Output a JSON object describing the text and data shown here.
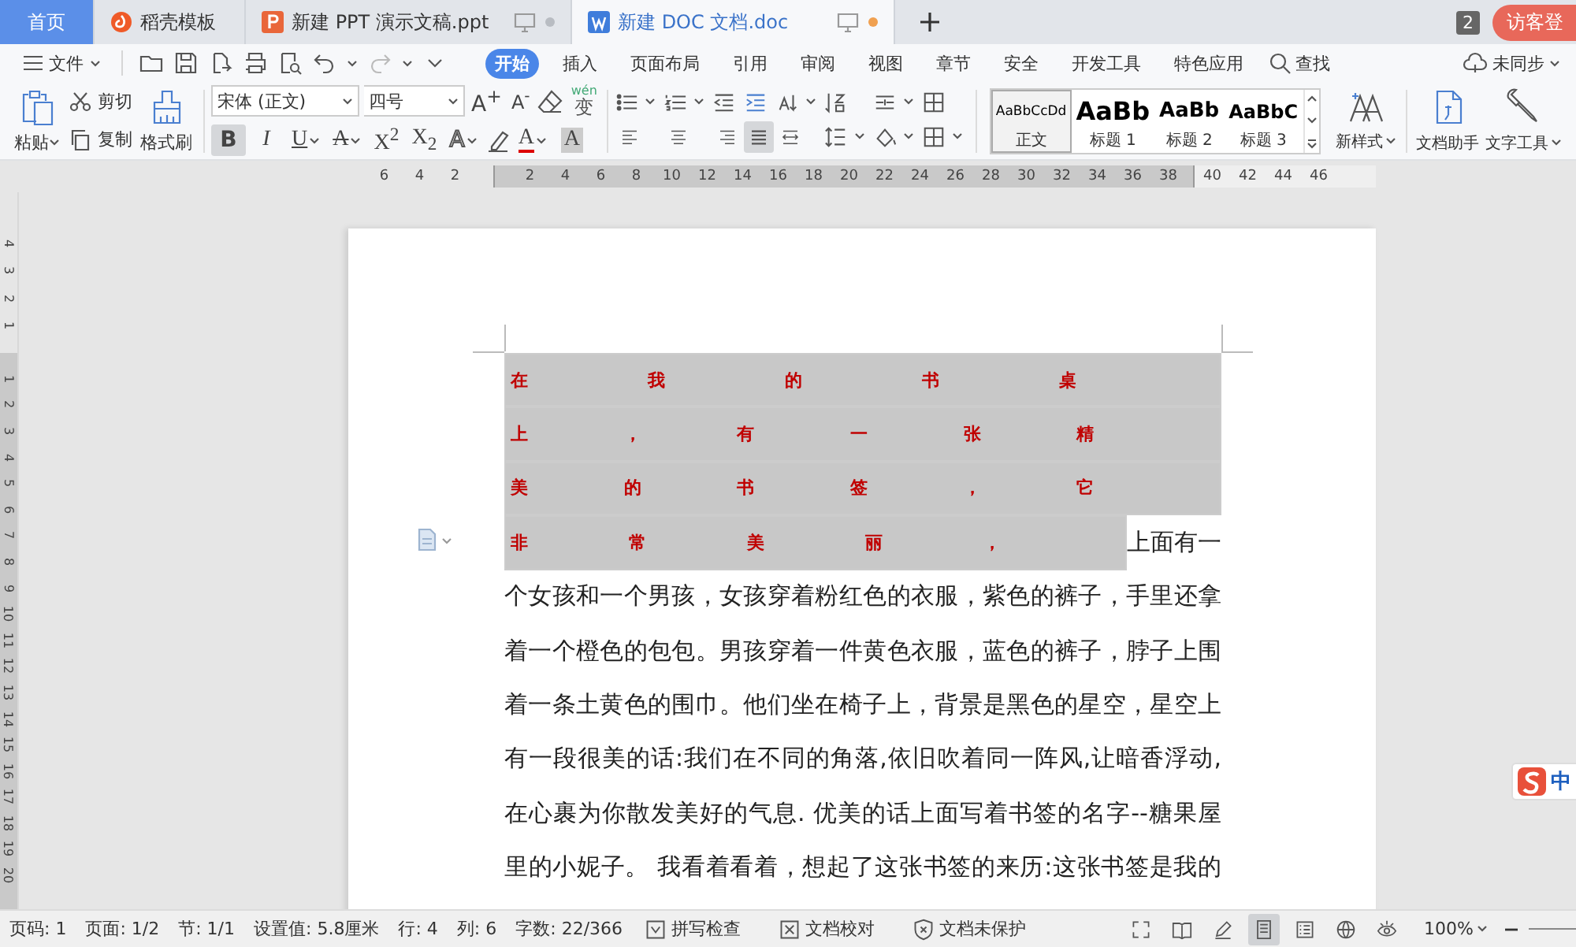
{
  "tab_bar": {
    "tabs": [
      {
        "label": "首页",
        "kind": "home",
        "selected": false
      },
      {
        "label": "稻壳模板",
        "kind": "template",
        "selected": false
      },
      {
        "label": "新建 PPT 演示文稿.ppt",
        "kind": "ppt",
        "selected": false,
        "unsaved": false
      },
      {
        "label": "新建 DOC 文档.doc",
        "kind": "doc",
        "selected": true,
        "unsaved": true
      }
    ],
    "window_count": "2",
    "login": "访客登"
  },
  "menu": {
    "file": "文件",
    "tabs": [
      {
        "label": "开始",
        "selected": true
      },
      {
        "label": "插入",
        "selected": false
      },
      {
        "label": "页面布局",
        "selected": false
      },
      {
        "label": "引用",
        "selected": false
      },
      {
        "label": "审阅",
        "selected": false
      },
      {
        "label": "视图",
        "selected": false
      },
      {
        "label": "章节",
        "selected": false
      },
      {
        "label": "安全",
        "selected": false
      },
      {
        "label": "开发工具",
        "selected": false
      },
      {
        "label": "特色应用",
        "selected": false
      }
    ],
    "search": "查找",
    "sync": "未同步"
  },
  "ribbon": {
    "clipboard": {
      "paste": "粘贴",
      "cut": "剪切",
      "copy": "复制",
      "format_painter": "格式刷"
    },
    "font": {
      "name": "宋体 (正文)",
      "size": "四号",
      "top_buttons": [
        {
          "label": "A$^{+}$",
          "kind": "grow",
          "selected": false
        },
        {
          "label": "A$^{-}$",
          "kind": "shrink",
          "selected": false
        }
      ],
      "phonetic": {
        "ruby": "wén",
        "label": "变"
      },
      "buttons": [
        {
          "label": "B",
          "kind": "bold",
          "selected": true
        },
        {
          "label": "I",
          "kind": "italic",
          "selected": false
        },
        {
          "label": "U",
          "kind": "underline",
          "selected": false
        },
        {
          "label": "A",
          "kind": "strike",
          "selected": false
        },
        {
          "label": "X$^{2}$",
          "kind": "sup",
          "selected": false
        },
        {
          "label": "X$_{2}$",
          "kind": "sub",
          "selected": false
        },
        {
          "label": "A",
          "kind": "effect",
          "selected": false
        },
        {
          "label": "A",
          "kind": "color",
          "selected": false
        },
        {
          "label": "A",
          "kind": "shade",
          "selected": false
        }
      ]
    },
    "alignment": [
      {
        "kind": "left",
        "selected": false
      },
      {
        "kind": "center",
        "selected": false
      },
      {
        "kind": "right",
        "selected": false
      },
      {
        "kind": "justify",
        "selected": true
      },
      {
        "kind": "distributed",
        "selected": false
      }
    ],
    "styles": [
      {
        "preview": "AaBbCcDd",
        "label": "正文",
        "kind": "body",
        "selected": true
      },
      {
        "preview": "AaBb",
        "label": "标题 1",
        "kind": "heading1",
        "selected": false
      },
      {
        "preview": "AaBb",
        "label": "标题 2",
        "kind": "heading2",
        "selected": false
      },
      {
        "preview": "AaBbC",
        "label": "标题 3",
        "kind": "heading3",
        "selected": false
      }
    ],
    "new_style": "新样式",
    "tools": [
      {
        "label": "文档助手",
        "kind": "assistant"
      },
      {
        "label": "文字工具",
        "kind": "text-tools"
      }
    ]
  },
  "ruler": {
    "left_marks": [
      "6",
      "4",
      "2"
    ],
    "marks": [
      "2",
      "4",
      "6",
      "8",
      "10",
      "12",
      "14",
      "16",
      "18",
      "20",
      "22",
      "24",
      "26",
      "28",
      "30",
      "32",
      "34",
      "36",
      "38"
    ],
    "right_marks": [
      "40",
      "42",
      "44",
      "46"
    ]
  },
  "vertical_ruler": {
    "top_marks": [
      "4",
      "3",
      "2",
      "1"
    ],
    "marks": [
      "1",
      "2",
      "3",
      "4",
      "5",
      "6",
      "7",
      "8",
      "9",
      "10",
      "11",
      "12",
      "13",
      "14",
      "15",
      "16",
      "17",
      "18",
      "19",
      "20"
    ]
  },
  "document": {
    "lines": [
      {
        "segments": [
          {
            "text": "在我的书桌",
            "selected": true
          }
        ]
      },
      {
        "segments": [
          {
            "text": "上，有一张精",
            "selected": true
          }
        ]
      },
      {
        "segments": [
          {
            "text": "美的书签，它",
            "selected": true
          }
        ]
      },
      {
        "segments": [
          {
            "text": "非常美丽，",
            "selected": true
          },
          {
            "text": "上面有一",
            "selected": false
          }
        ]
      },
      {
        "segments": [
          {
            "text": "个女孩和一个男孩，女孩穿着粉红色的衣服，紫色的裤子，手里还拿",
            "selected": false
          }
        ]
      },
      {
        "segments": [
          {
            "text": "着一个橙色的包包。男孩穿着一件黄色衣服，蓝色的裤子，脖子上围",
            "selected": false
          }
        ]
      },
      {
        "segments": [
          {
            "text": "着一条土黄色的围巾。他们坐在椅子上，背景是黑色的星空，星空上",
            "selected": false
          }
        ]
      },
      {
        "segments": [
          {
            "text": "有一段很美的话:我们在不同的角落,依旧吹着同一阵风,让暗香浮动,",
            "selected": false
          }
        ]
      },
      {
        "segments": [
          {
            "text": "在心裹为你散发美好的气息. 优美的话上面写着书签的名字--糖果屋",
            "selected": false
          }
        ]
      },
      {
        "segments": [
          {
            "text": "里的小妮子。 我看着看着，想起了这张书签的来历:这张书签是我的",
            "selected": false
          }
        ]
      }
    ]
  },
  "ime": {
    "mode": "中"
  },
  "status_bar": {
    "items": [
      "页码: 1",
      "页面: 1/2",
      "节: 1/1",
      "设置值: 5.8厘米",
      "行: 4",
      "列: 6",
      "字数: 22/366"
    ],
    "buttons": [
      {
        "label": "拼写检查",
        "kind": "spell"
      },
      {
        "label": "文档校对",
        "kind": "proof"
      },
      {
        "label": "文档未保护",
        "kind": "protect"
      }
    ],
    "views": [
      {
        "kind": "fullscreen",
        "selected": false
      },
      {
        "kind": "read",
        "selected": false
      },
      {
        "kind": "pen",
        "selected": false
      },
      {
        "kind": "page",
        "selected": true
      },
      {
        "kind": "outline",
        "selected": false
      },
      {
        "kind": "web",
        "selected": false
      },
      {
        "kind": "eye",
        "selected": false
      }
    ],
    "zoom": "100%"
  }
}
